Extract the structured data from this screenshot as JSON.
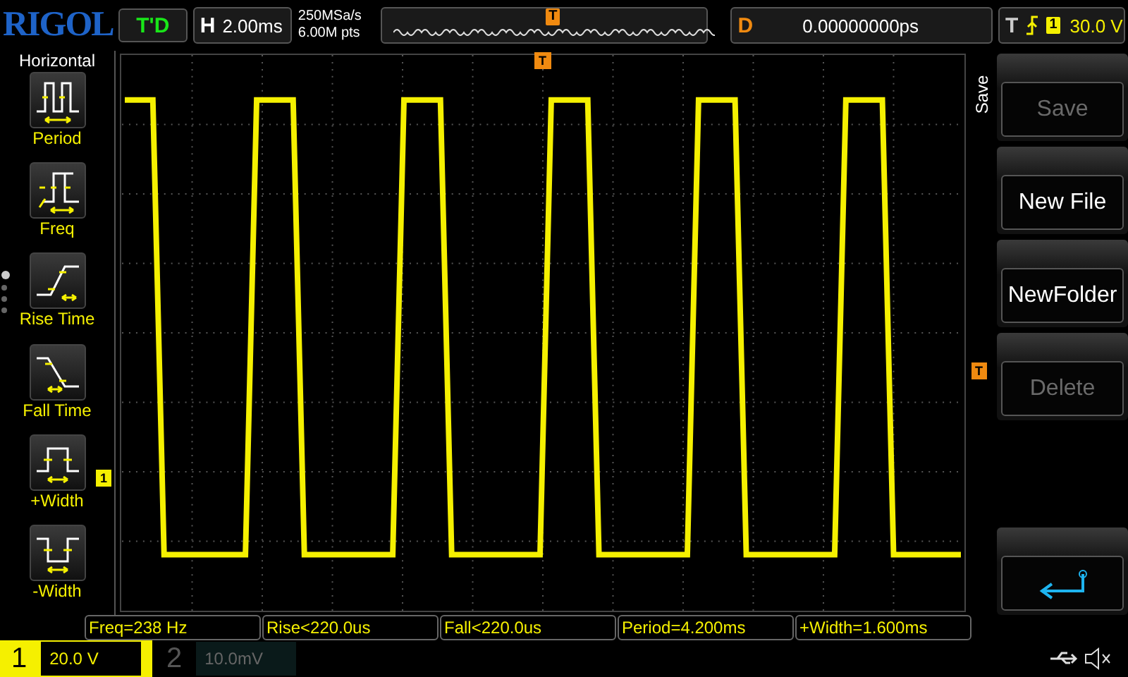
{
  "header": {
    "brand": "RIGOL",
    "run_status": "T'D",
    "horizontal": {
      "label": "H",
      "value": "2.00ms"
    },
    "sample_rate": "250MSa/s",
    "memory_depth": "6.00M pts",
    "delay": {
      "label": "D",
      "value": "0.00000000ps"
    },
    "trigger": {
      "label": "T",
      "source": "1",
      "level": "30.0 V"
    }
  },
  "left_menu": {
    "title": "Horizontal",
    "items": [
      {
        "kind": "period",
        "label": "Period"
      },
      {
        "kind": "freq",
        "label": "Freq"
      },
      {
        "kind": "rise",
        "label": "Rise Time"
      },
      {
        "kind": "fall",
        "label": "Fall Time"
      },
      {
        "kind": "pwidth",
        "label": "+Width"
      },
      {
        "kind": "nwidth",
        "label": "-Width"
      }
    ],
    "pages": [
      {
        "selected": true
      },
      {
        "selected": false
      },
      {
        "selected": false
      },
      {
        "selected": false
      }
    ]
  },
  "display": {
    "overview_trigger_marker": "T",
    "trigger_position_marker": "T",
    "trigger_level_marker": "T",
    "channel_marker": "1"
  },
  "right_menu": {
    "title": "Save",
    "buttons": [
      {
        "label": "Save",
        "disabled": true
      },
      {
        "label": "New File",
        "disabled": false
      },
      {
        "label": "NewFolder",
        "disabled": false
      },
      {
        "label": "Delete",
        "disabled": true
      }
    ]
  },
  "measurements": [
    "Freq=238 Hz",
    "Rise<220.0us",
    "Fall<220.0us",
    "Period=4.200ms",
    "+Width=1.600ms"
  ],
  "channels": [
    {
      "number": "1",
      "scale": "20.0 V",
      "active": true
    },
    {
      "number": "2",
      "scale": "10.0mV",
      "active": false
    }
  ]
}
